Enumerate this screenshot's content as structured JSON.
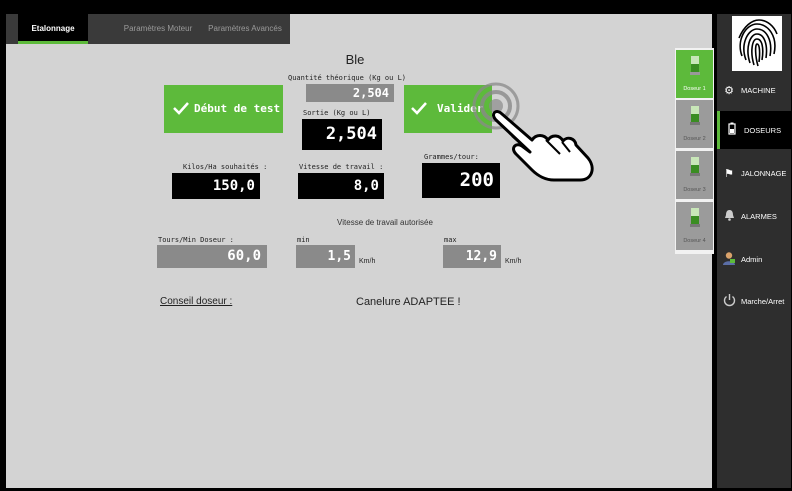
{
  "tabs": [
    {
      "label": "Etalonnage",
      "active": true
    },
    {
      "label": "Paramètres Moteur",
      "active": false
    },
    {
      "label": "Paramètres Avancés",
      "active": false
    }
  ],
  "product": "Ble",
  "qty_label": "Quantité théorique (Kg ou L)",
  "qty_value": "2,504",
  "sortie_label": "Sortie (Kg ou L)",
  "sortie_value": "2,504",
  "start_button": "Début de test",
  "validate_button": "Valider",
  "kilos_label": "Kilos/Ha souhaités :",
  "kilos_value": "150,0",
  "speed_label": "Vitesse de travail :",
  "speed_value": "8,0",
  "grammes_label": "Grammes/tour:",
  "grammes_value": "200",
  "authorized_title": "Vitesse de travail autorisée",
  "tours_label": "Tours/Min Doseur :",
  "tours_value": "60,0",
  "min_label": "min",
  "min_value": "1,5",
  "max_label": "max",
  "max_value": "12,9",
  "unit_kmh": "Km/h",
  "conseil_label": "Conseil doseur :",
  "conseil_value": "Canelure ADAPTEE !",
  "doseurs": [
    {
      "label": "Doseur 1",
      "active": true
    },
    {
      "label": "Doseur 2",
      "active": false
    },
    {
      "label": "Doseur 3",
      "active": false
    },
    {
      "label": "Doseur 4",
      "active": false
    }
  ],
  "sidebar": [
    {
      "label": "MACHINE",
      "icon": "gear-icon",
      "active": false
    },
    {
      "label": "DOSEURS",
      "icon": "battery-icon",
      "active": true
    },
    {
      "label": "JALONNAGE",
      "icon": "flag-icon",
      "active": false
    },
    {
      "label": "ALARMES",
      "icon": "bell-icon",
      "active": false
    },
    {
      "label": "Admin",
      "icon": "user-icon",
      "active": false
    },
    {
      "label": "Marche/Arret",
      "icon": "power-icon",
      "active": false
    }
  ],
  "colors": {
    "accent": "#5dba3b",
    "sidebar": "#2e2e2e",
    "panel": "#d3d3d3"
  }
}
